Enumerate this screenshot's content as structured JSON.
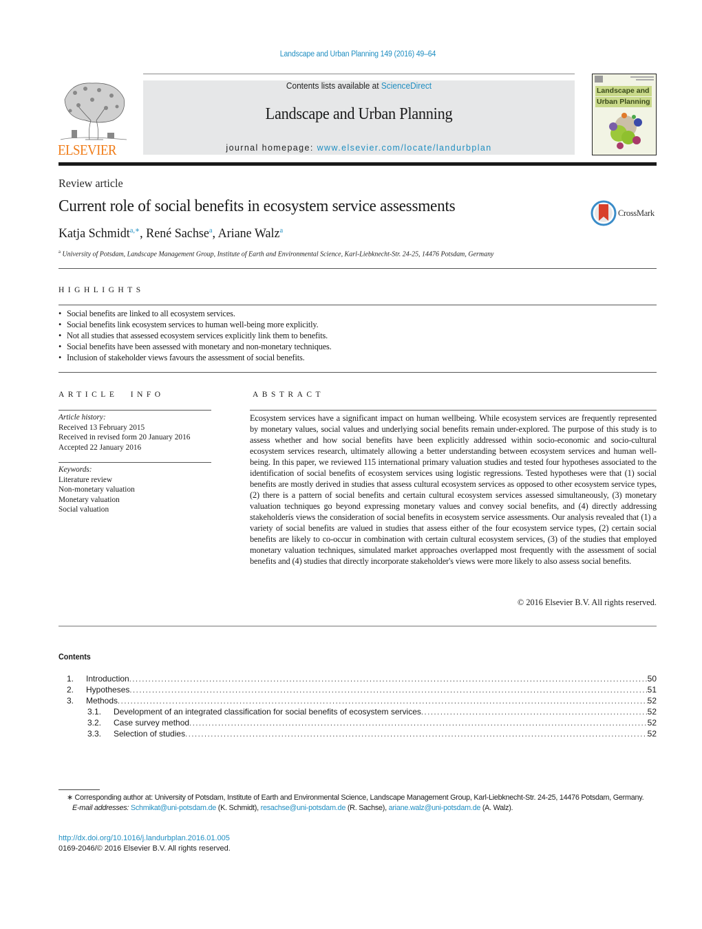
{
  "header": {
    "journal_reference": "Landscape and Urban Planning 149 (2016) 49–64",
    "contents_available_prefix": "Contents lists available at ",
    "contents_available_link": "ScienceDirect",
    "journal_name": "Landscape and Urban Planning",
    "homepage_prefix": "journal homepage: ",
    "homepage_link": "www.elsevier.com/locate/landurbplan",
    "publisher_wordmark": "ELSEVIER",
    "cover_title_line1": "Landscape and",
    "cover_title_line2": "Urban Planning",
    "crossmark_label": "CrossMark",
    "colors": {
      "link": "#1f8ec1",
      "elsevier_orange": "#f07d1a",
      "masthead_bg": "#e6e7e8"
    }
  },
  "article": {
    "type": "Review article",
    "title": "Current role of social benefits in ecosystem service assessments",
    "authors": [
      {
        "name": "Katja Schmidt",
        "sup": "a,∗",
        "sep": ", "
      },
      {
        "name": "René Sachse",
        "sup": "a",
        "sep": ", "
      },
      {
        "name": "Ariane Walz",
        "sup": "a",
        "sep": ""
      }
    ],
    "affiliation_sup": "a",
    "affiliation": "University of Potsdam, Landscape Management Group, Institute of Earth and Environmental Science, Karl-Liebknecht-Str. 24-25, 14476 Potsdam, Germany"
  },
  "highlights": {
    "heading": "HIGHLIGHTS",
    "items": [
      "Social benefits are linked to all ecosystem services.",
      "Social benefits link ecosystem services to human well-being more explicitly.",
      "Not all studies that assessed ecosystem services explicitly link them to benefits.",
      "Social benefits have been assessed with monetary and non-monetary techniques.",
      "Inclusion of stakeholder views favours the assessment of social benefits."
    ]
  },
  "article_info": {
    "heading": "ARTICLE INFO",
    "history_label": "Article history:",
    "history": [
      "Received 13 February 2015",
      "Received in revised form 20 January 2016",
      "Accepted 22 January 2016"
    ],
    "keywords_label": "Keywords:",
    "keywords": [
      "Literature review",
      "Non-monetary valuation",
      "Monetary valuation",
      "Social valuation"
    ]
  },
  "abstract": {
    "heading": "ABSTRACT",
    "text": "Ecosystem services have a significant impact on human wellbeing. While ecosystem services are frequently represented by monetary values, social values and underlying social benefits remain under-explored. The purpose of this study is to assess whether and how social benefits have been explicitly addressed within socio-economic and socio-cultural ecosystem services research, ultimately allowing a better understanding between ecosystem services and human well-being. In this paper, we reviewed 115 international primary valuation studies and tested four hypotheses associated to the identification of social benefits of ecosystem services using logistic regressions. Tested hypotheses were that (1) social benefits are mostly derived in studies that assess cultural ecosystem services as opposed to other ecosystem service types, (2) there is a pattern of social benefits and certain cultural ecosystem services assessed simultaneously, (3) monetary valuation techniques go beyond expressing monetary values and convey social benefits, and (4) directly addressing stakeholderís views the consideration of social benefits in ecosystem service assessments. Our analysis revealed that (1) a variety of social benefits are valued in studies that assess either of the four ecosystem service types, (2) certain social benefits are likely to co-occur in combination with certain cultural ecosystem services, (3) of the studies that employed monetary valuation techniques, simulated market approaches overlapped most frequently with the assessment of social benefits and (4) studies that directly incorporate stakeholder's views were more likely to also assess social benefits.",
    "copyright": "© 2016 Elsevier B.V. All rights reserved."
  },
  "contents": {
    "heading": "Contents",
    "entries": [
      {
        "num": "1.",
        "label": "Introduction",
        "page": "50",
        "level": 1
      },
      {
        "num": "2.",
        "label": "Hypotheses",
        "page": "51",
        "level": 1
      },
      {
        "num": "3.",
        "label": "Methods",
        "page": "52",
        "level": 1
      },
      {
        "num": "3.1.",
        "label": "Development of an integrated classification for social benefits of ecosystem services",
        "page": "52",
        "level": 2
      },
      {
        "num": "3.2.",
        "label": "Case survey method",
        "page": "52",
        "level": 2
      },
      {
        "num": "3.3.",
        "label": "Selection of studies",
        "page": "52",
        "level": 2
      }
    ]
  },
  "footnotes": {
    "corresponding": "∗ Corresponding author at: University of Potsdam, Institute of Earth and Environmental Science, Landscape Management Group, Karl-Liebknecht-Str. 24-25, 14476 Potsdam, Germany.",
    "email_label": "E-mail addresses:",
    "emails": [
      {
        "address": "Schmikat@uni-potsdam.de",
        "who": " (K. Schmidt), "
      },
      {
        "address": "resachse@uni-potsdam.de",
        "who": " (R. Sachse), "
      },
      {
        "address": "ariane.walz@uni-potsdam.de",
        "who": " (A. Walz)."
      }
    ],
    "doi": "http://dx.doi.org/10.1016/j.landurbplan.2016.01.005",
    "issn_copyright": "0169-2046/© 2016 Elsevier B.V. All rights reserved."
  }
}
